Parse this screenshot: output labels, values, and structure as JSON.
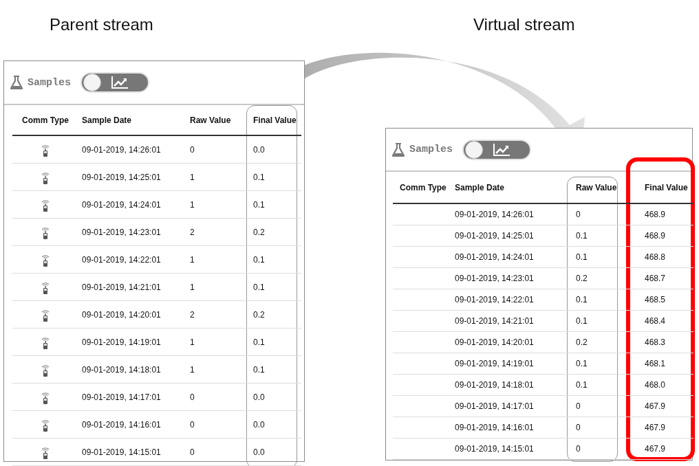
{
  "streams": [
    {
      "caption": "Parent stream",
      "title": "Samples",
      "toggle": {
        "on": false
      },
      "columns": [
        {
          "label": "Comm Type",
          "outlined": false,
          "emphasized": false
        },
        {
          "label": "Sample Date",
          "outlined": false,
          "emphasized": false
        },
        {
          "label": "Raw Value",
          "outlined": false,
          "emphasized": false
        },
        {
          "label": "Final Value",
          "outlined": true,
          "emphasized": false
        }
      ],
      "rows": [
        {
          "comm_icon": true,
          "date": "09-01-2019, 14:26:01",
          "raw": "0",
          "final": "0.0"
        },
        {
          "comm_icon": true,
          "date": "09-01-2019, 14:25:01",
          "raw": "1",
          "final": "0.1"
        },
        {
          "comm_icon": true,
          "date": "09-01-2019, 14:24:01",
          "raw": "1",
          "final": "0.1"
        },
        {
          "comm_icon": true,
          "date": "09-01-2019, 14:23:01",
          "raw": "2",
          "final": "0.2"
        },
        {
          "comm_icon": true,
          "date": "09-01-2019, 14:22:01",
          "raw": "1",
          "final": "0.1"
        },
        {
          "comm_icon": true,
          "date": "09-01-2019, 14:21:01",
          "raw": "1",
          "final": "0.1"
        },
        {
          "comm_icon": true,
          "date": "09-01-2019, 14:20:01",
          "raw": "2",
          "final": "0.2"
        },
        {
          "comm_icon": true,
          "date": "09-01-2019, 14:19:01",
          "raw": "1",
          "final": "0.1"
        },
        {
          "comm_icon": true,
          "date": "09-01-2019, 14:18:01",
          "raw": "1",
          "final": "0.1"
        },
        {
          "comm_icon": true,
          "date": "09-01-2019, 14:17:01",
          "raw": "0",
          "final": "0.0"
        },
        {
          "comm_icon": true,
          "date": "09-01-2019, 14:16:01",
          "raw": "0",
          "final": "0.0"
        },
        {
          "comm_icon": true,
          "date": "09-01-2019, 14:15:01",
          "raw": "0",
          "final": "0.0"
        }
      ]
    },
    {
      "caption": "Virtual stream",
      "title": "Samples",
      "toggle": {
        "on": false
      },
      "columns": [
        {
          "label": "Comm Type",
          "outlined": false,
          "emphasized": false
        },
        {
          "label": "Sample Date",
          "outlined": false,
          "emphasized": false
        },
        {
          "label": "Raw Value",
          "outlined": true,
          "emphasized": false
        },
        {
          "label": "Final Value",
          "outlined": false,
          "emphasized": true
        }
      ],
      "rows": [
        {
          "comm_icon": false,
          "date": "09-01-2019, 14:26:01",
          "raw": "0",
          "final": "468.9"
        },
        {
          "comm_icon": false,
          "date": "09-01-2019, 14:25:01",
          "raw": "0.1",
          "final": "468.9"
        },
        {
          "comm_icon": false,
          "date": "09-01-2019, 14:24:01",
          "raw": "0.1",
          "final": "468.8"
        },
        {
          "comm_icon": false,
          "date": "09-01-2019, 14:23:01",
          "raw": "0.2",
          "final": "468.7"
        },
        {
          "comm_icon": false,
          "date": "09-01-2019, 14:22:01",
          "raw": "0.1",
          "final": "468.5"
        },
        {
          "comm_icon": false,
          "date": "09-01-2019, 14:21:01",
          "raw": "0.1",
          "final": "468.4"
        },
        {
          "comm_icon": false,
          "date": "09-01-2019, 14:20:01",
          "raw": "0.2",
          "final": "468.3"
        },
        {
          "comm_icon": false,
          "date": "09-01-2019, 14:19:01",
          "raw": "0.1",
          "final": "468.1"
        },
        {
          "comm_icon": false,
          "date": "09-01-2019, 14:18:01",
          "raw": "0.1",
          "final": "468.0"
        },
        {
          "comm_icon": false,
          "date": "09-01-2019, 14:17:01",
          "raw": "0",
          "final": "467.9"
        },
        {
          "comm_icon": false,
          "date": "09-01-2019, 14:16:01",
          "raw": "0",
          "final": "467.9"
        },
        {
          "comm_icon": false,
          "date": "09-01-2019, 14:15:01",
          "raw": "0",
          "final": "467.9"
        }
      ]
    }
  ]
}
